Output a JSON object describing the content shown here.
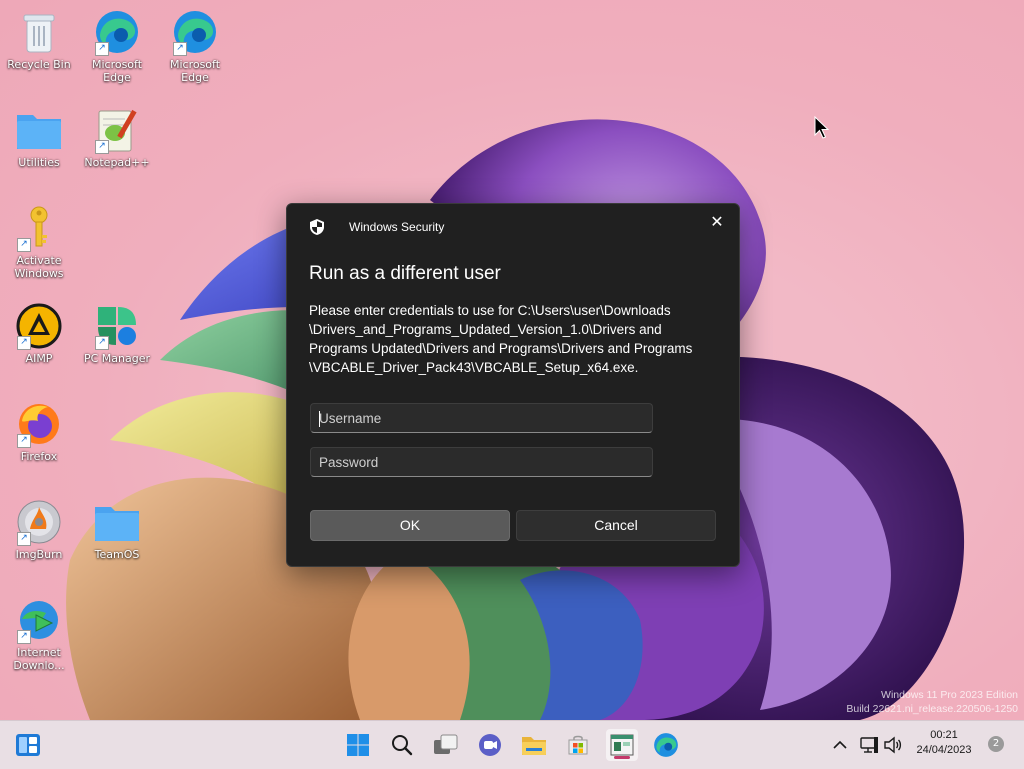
{
  "desktop": {
    "icons": [
      {
        "label": "Recycle Bin",
        "icon": "recycle-bin-icon"
      },
      {
        "label": "Microsoft Edge",
        "icon": "edge-icon"
      },
      {
        "label": "Microsoft Edge",
        "icon": "edge-icon"
      },
      {
        "label": "Utilities",
        "icon": "folder-icon"
      },
      {
        "label": "Notepad++",
        "icon": "notepadpp-icon"
      },
      {
        "label": "Activate Windows",
        "icon": "key-icon"
      },
      {
        "label": "AIMP",
        "icon": "aimp-icon"
      },
      {
        "label": "PC Manager",
        "icon": "pc-manager-icon"
      },
      {
        "label": "Firefox",
        "icon": "firefox-icon"
      },
      {
        "label": "ImgBurn",
        "icon": "imgburn-icon"
      },
      {
        "label": "TeamOS",
        "icon": "folder-icon"
      },
      {
        "label": "Internet Downlo...",
        "icon": "idm-icon"
      }
    ]
  },
  "dialog": {
    "app_name": "Windows Security",
    "title": "Run as a different user",
    "message": "Please enter credentials to use for C:\\Users\\user\\Downloads\n\\Drivers_and_Programs_Updated_Version_1.0\\Drivers and\nPrograms Updated\\Drivers and Programs\\Drivers and Programs\n\\VBCABLE_Driver_Pack43\\VBCABLE_Setup_x64.exe.",
    "username_placeholder": "Username",
    "password_placeholder": "Password",
    "ok_label": "OK",
    "cancel_label": "Cancel",
    "close_glyph": "✕"
  },
  "watermark": {
    "line1": "Windows 11 Pro 2023 Edition",
    "line2": "Build 22621.ni_release.220506-1250"
  },
  "taskbar": {
    "clock_time": "00:21",
    "clock_date": "24/04/2023",
    "notification_count": "2",
    "accent": "#c43a6b"
  }
}
